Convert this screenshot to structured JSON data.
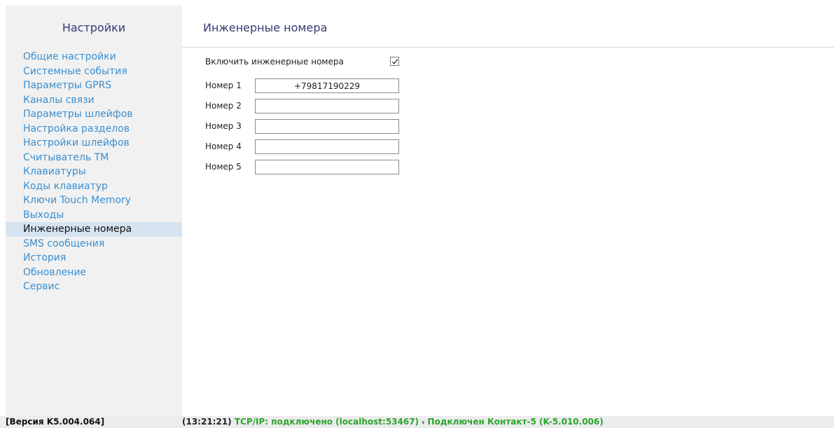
{
  "sidebar": {
    "title": "Настройки",
    "items": [
      {
        "label": "Общие настройки"
      },
      {
        "label": "Системные события"
      },
      {
        "label": "Параметры GPRS"
      },
      {
        "label": "Каналы связи"
      },
      {
        "label": "Параметры шлейфов"
      },
      {
        "label": "Настройка разделов"
      },
      {
        "label": "Настройки шлейфов"
      },
      {
        "label": "Считыватель ТМ"
      },
      {
        "label": "Клавиатуры"
      },
      {
        "label": "Коды клавиатур"
      },
      {
        "label": "Ключи Touch Memory"
      },
      {
        "label": "Выходы"
      },
      {
        "label": "Инженерные номера"
      },
      {
        "label": "SMS сообщения"
      },
      {
        "label": "История"
      },
      {
        "label": "Обновление"
      },
      {
        "label": "Сервис"
      }
    ],
    "active_item": "Инженерные номера"
  },
  "main": {
    "title": "Инженерные номера",
    "enable": {
      "label": "Включить инженерные номера",
      "checked": true
    },
    "numbers": [
      {
        "label": "Номер 1",
        "value": "+79817190229"
      },
      {
        "label": "Номер 2",
        "value": ""
      },
      {
        "label": "Номер 3",
        "value": ""
      },
      {
        "label": "Номер 4",
        "value": ""
      },
      {
        "label": "Номер 5",
        "value": ""
      }
    ]
  },
  "statusbar": {
    "version": "[Версия K5.004.064]",
    "time": "(13:21:21)",
    "connection": "TCP/IP: подключено (localhost:53467)",
    "separator": "›",
    "device": "Подключен Контакт-5 (K-5.010.006)"
  },
  "colors": {
    "link": "#3a8fd0",
    "title": "#333a73",
    "active_bg": "#d6e4f1",
    "status_ok": "#2ca52c",
    "sidebar_bg": "#f1f1f1"
  },
  "icons": {
    "checkbox_mark": "checkmark-icon"
  }
}
